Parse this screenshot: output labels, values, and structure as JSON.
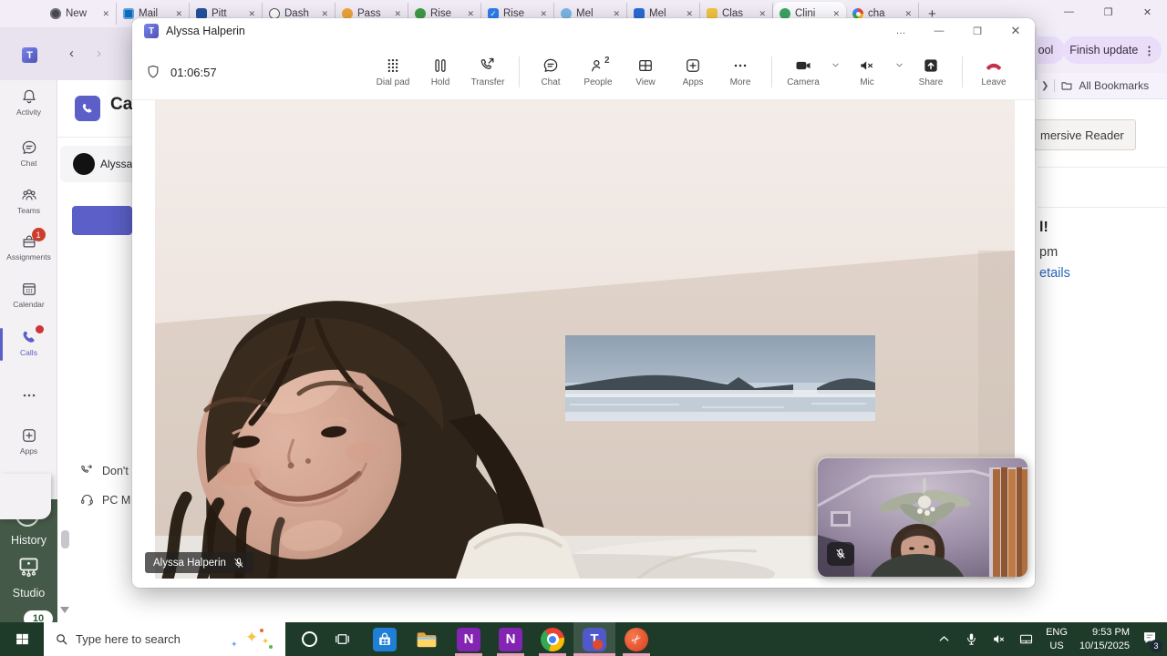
{
  "browser": {
    "tabs": [
      {
        "label": "New",
        "icon": "globe",
        "active": false
      },
      {
        "label": "Mail",
        "icon": "outlook",
        "active": false
      },
      {
        "label": "Pitt",
        "icon": "pitt",
        "active": false
      },
      {
        "label": "Dash",
        "icon": "dash",
        "active": false
      },
      {
        "label": "Pass",
        "icon": "pass",
        "active": false
      },
      {
        "label": "Rise",
        "icon": "rise-green",
        "active": false
      },
      {
        "label": "Rise",
        "icon": "rise-check",
        "active": false
      },
      {
        "label": "Mel",
        "icon": "mel-light",
        "active": false
      },
      {
        "label": "Mel",
        "icon": "mel-blue",
        "active": false
      },
      {
        "label": "Clas",
        "icon": "clas",
        "active": false
      },
      {
        "label": "Clini",
        "icon": "clini",
        "active": true
      },
      {
        "label": "cha",
        "icon": "google",
        "active": false
      }
    ],
    "toolbar_pills": {
      "school_fragment": "ool",
      "finish_update": "Finish update"
    },
    "bookmarks_bar": {
      "all_bookmarks": "All Bookmarks"
    },
    "page_fragments": {
      "immersive_reader": "mersive Reader",
      "headline": "l!",
      "time": "pm",
      "details_link": "etails"
    }
  },
  "teams_app": {
    "rail": [
      {
        "id": "activity",
        "label": "Activity",
        "icon": "bell"
      },
      {
        "id": "chat",
        "label": "Chat",
        "icon": "chat"
      },
      {
        "id": "teams",
        "label": "Teams",
        "icon": "teams-people"
      },
      {
        "id": "assignments",
        "label": "Assignments",
        "icon": "assignments",
        "badge": "1"
      },
      {
        "id": "calendar",
        "label": "Calendar",
        "icon": "calendar"
      },
      {
        "id": "calls",
        "label": "Calls",
        "icon": "phone",
        "active": true,
        "dot": true
      },
      {
        "id": "more",
        "label": "",
        "icon": "more-dots"
      },
      {
        "id": "apps",
        "label": "Apps",
        "icon": "apps-plus"
      }
    ],
    "calls_page": {
      "heading_fragment": "Ca",
      "contact_fragment": "Alyssa",
      "dont_fragment": "Don't",
      "pc_mic_fragment": "PC M"
    }
  },
  "side_panel": {
    "history_label": "History",
    "studio_label": "Studio",
    "badge": "10"
  },
  "call_window": {
    "title": "Alyssa Halperin",
    "timer": "01:06:57",
    "toolbar": [
      {
        "id": "dialpad",
        "label": "Dial pad",
        "icon": "dialpad"
      },
      {
        "id": "hold",
        "label": "Hold",
        "icon": "hold"
      },
      {
        "id": "transfer",
        "label": "Transfer",
        "icon": "transfer"
      },
      {
        "id": "divider1",
        "divider": true
      },
      {
        "id": "chat",
        "label": "Chat",
        "icon": "chat"
      },
      {
        "id": "people",
        "label": "People",
        "icon": "people",
        "count": "2"
      },
      {
        "id": "view",
        "label": "View",
        "icon": "view"
      },
      {
        "id": "apps",
        "label": "Apps",
        "icon": "apps-plus"
      },
      {
        "id": "more",
        "label": "More",
        "icon": "more-dots"
      },
      {
        "id": "divider2",
        "divider": true
      },
      {
        "id": "camera",
        "label": "Camera",
        "icon": "camera",
        "chevron": true
      },
      {
        "id": "mic",
        "label": "Mic",
        "icon": "speaker-muted",
        "chevron": true
      },
      {
        "id": "share",
        "label": "Share",
        "icon": "share"
      },
      {
        "id": "divider3",
        "divider": true
      },
      {
        "id": "leave",
        "label": "Leave",
        "icon": "leave"
      }
    ],
    "participant_nametag": "Alyssa Halperin"
  },
  "taskbar": {
    "search_placeholder": "Type here to search",
    "apps": [
      "store",
      "explorer",
      "onenote",
      "onenote",
      "chrome",
      "teams",
      "snip"
    ],
    "tray": {
      "language": "ENG",
      "region": "US",
      "time": "9:53 PM",
      "date": "10/15/2025",
      "notification_count": "3"
    }
  }
}
